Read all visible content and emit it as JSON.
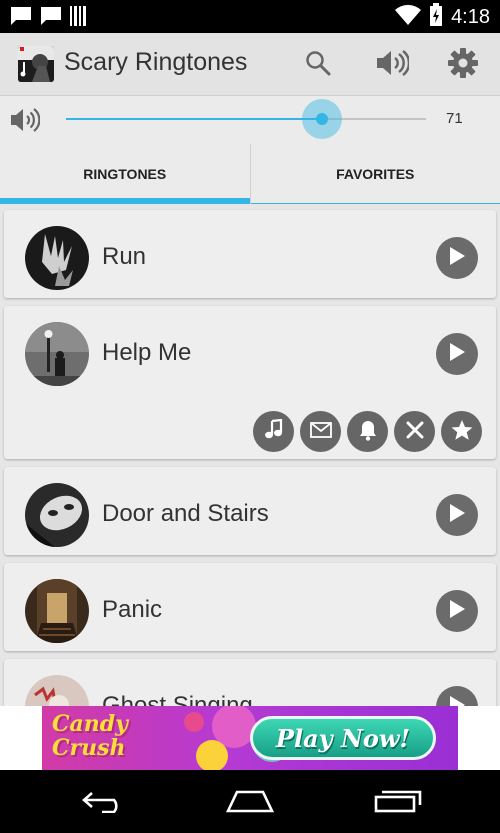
{
  "status_bar": {
    "time": "4:18",
    "icons": [
      "chat-icon",
      "chat-icon",
      "barcode-icon",
      "wifi-icon",
      "battery-charging-icon"
    ]
  },
  "action_bar": {
    "title": "Scary Ringtones",
    "actions": [
      "search-icon",
      "volume-icon",
      "settings-icon"
    ]
  },
  "volume": {
    "value": "71",
    "level_percent": 71
  },
  "tabs": [
    {
      "label": "RINGTONES",
      "selected": true
    },
    {
      "label": "FAVORITES",
      "selected": false
    }
  ],
  "ringtones": [
    {
      "title": "Run"
    },
    {
      "title": "Help Me",
      "expanded": true,
      "actions": [
        "music-note-icon",
        "envelope-icon",
        "bell-icon",
        "close-icon",
        "star-icon"
      ]
    },
    {
      "title": "Door and Stairs"
    },
    {
      "title": "Panic"
    },
    {
      "title": "Ghost Singing"
    }
  ],
  "ad": {
    "brand": "Candy Crush",
    "cta": "Play Now!"
  },
  "nav": [
    "back-icon",
    "home-icon",
    "recents-icon"
  ],
  "colors": {
    "accent": "#33b5e5",
    "action_bar": "#e3e3e3",
    "card": "#eeeeee",
    "button_dark": "#666666"
  }
}
